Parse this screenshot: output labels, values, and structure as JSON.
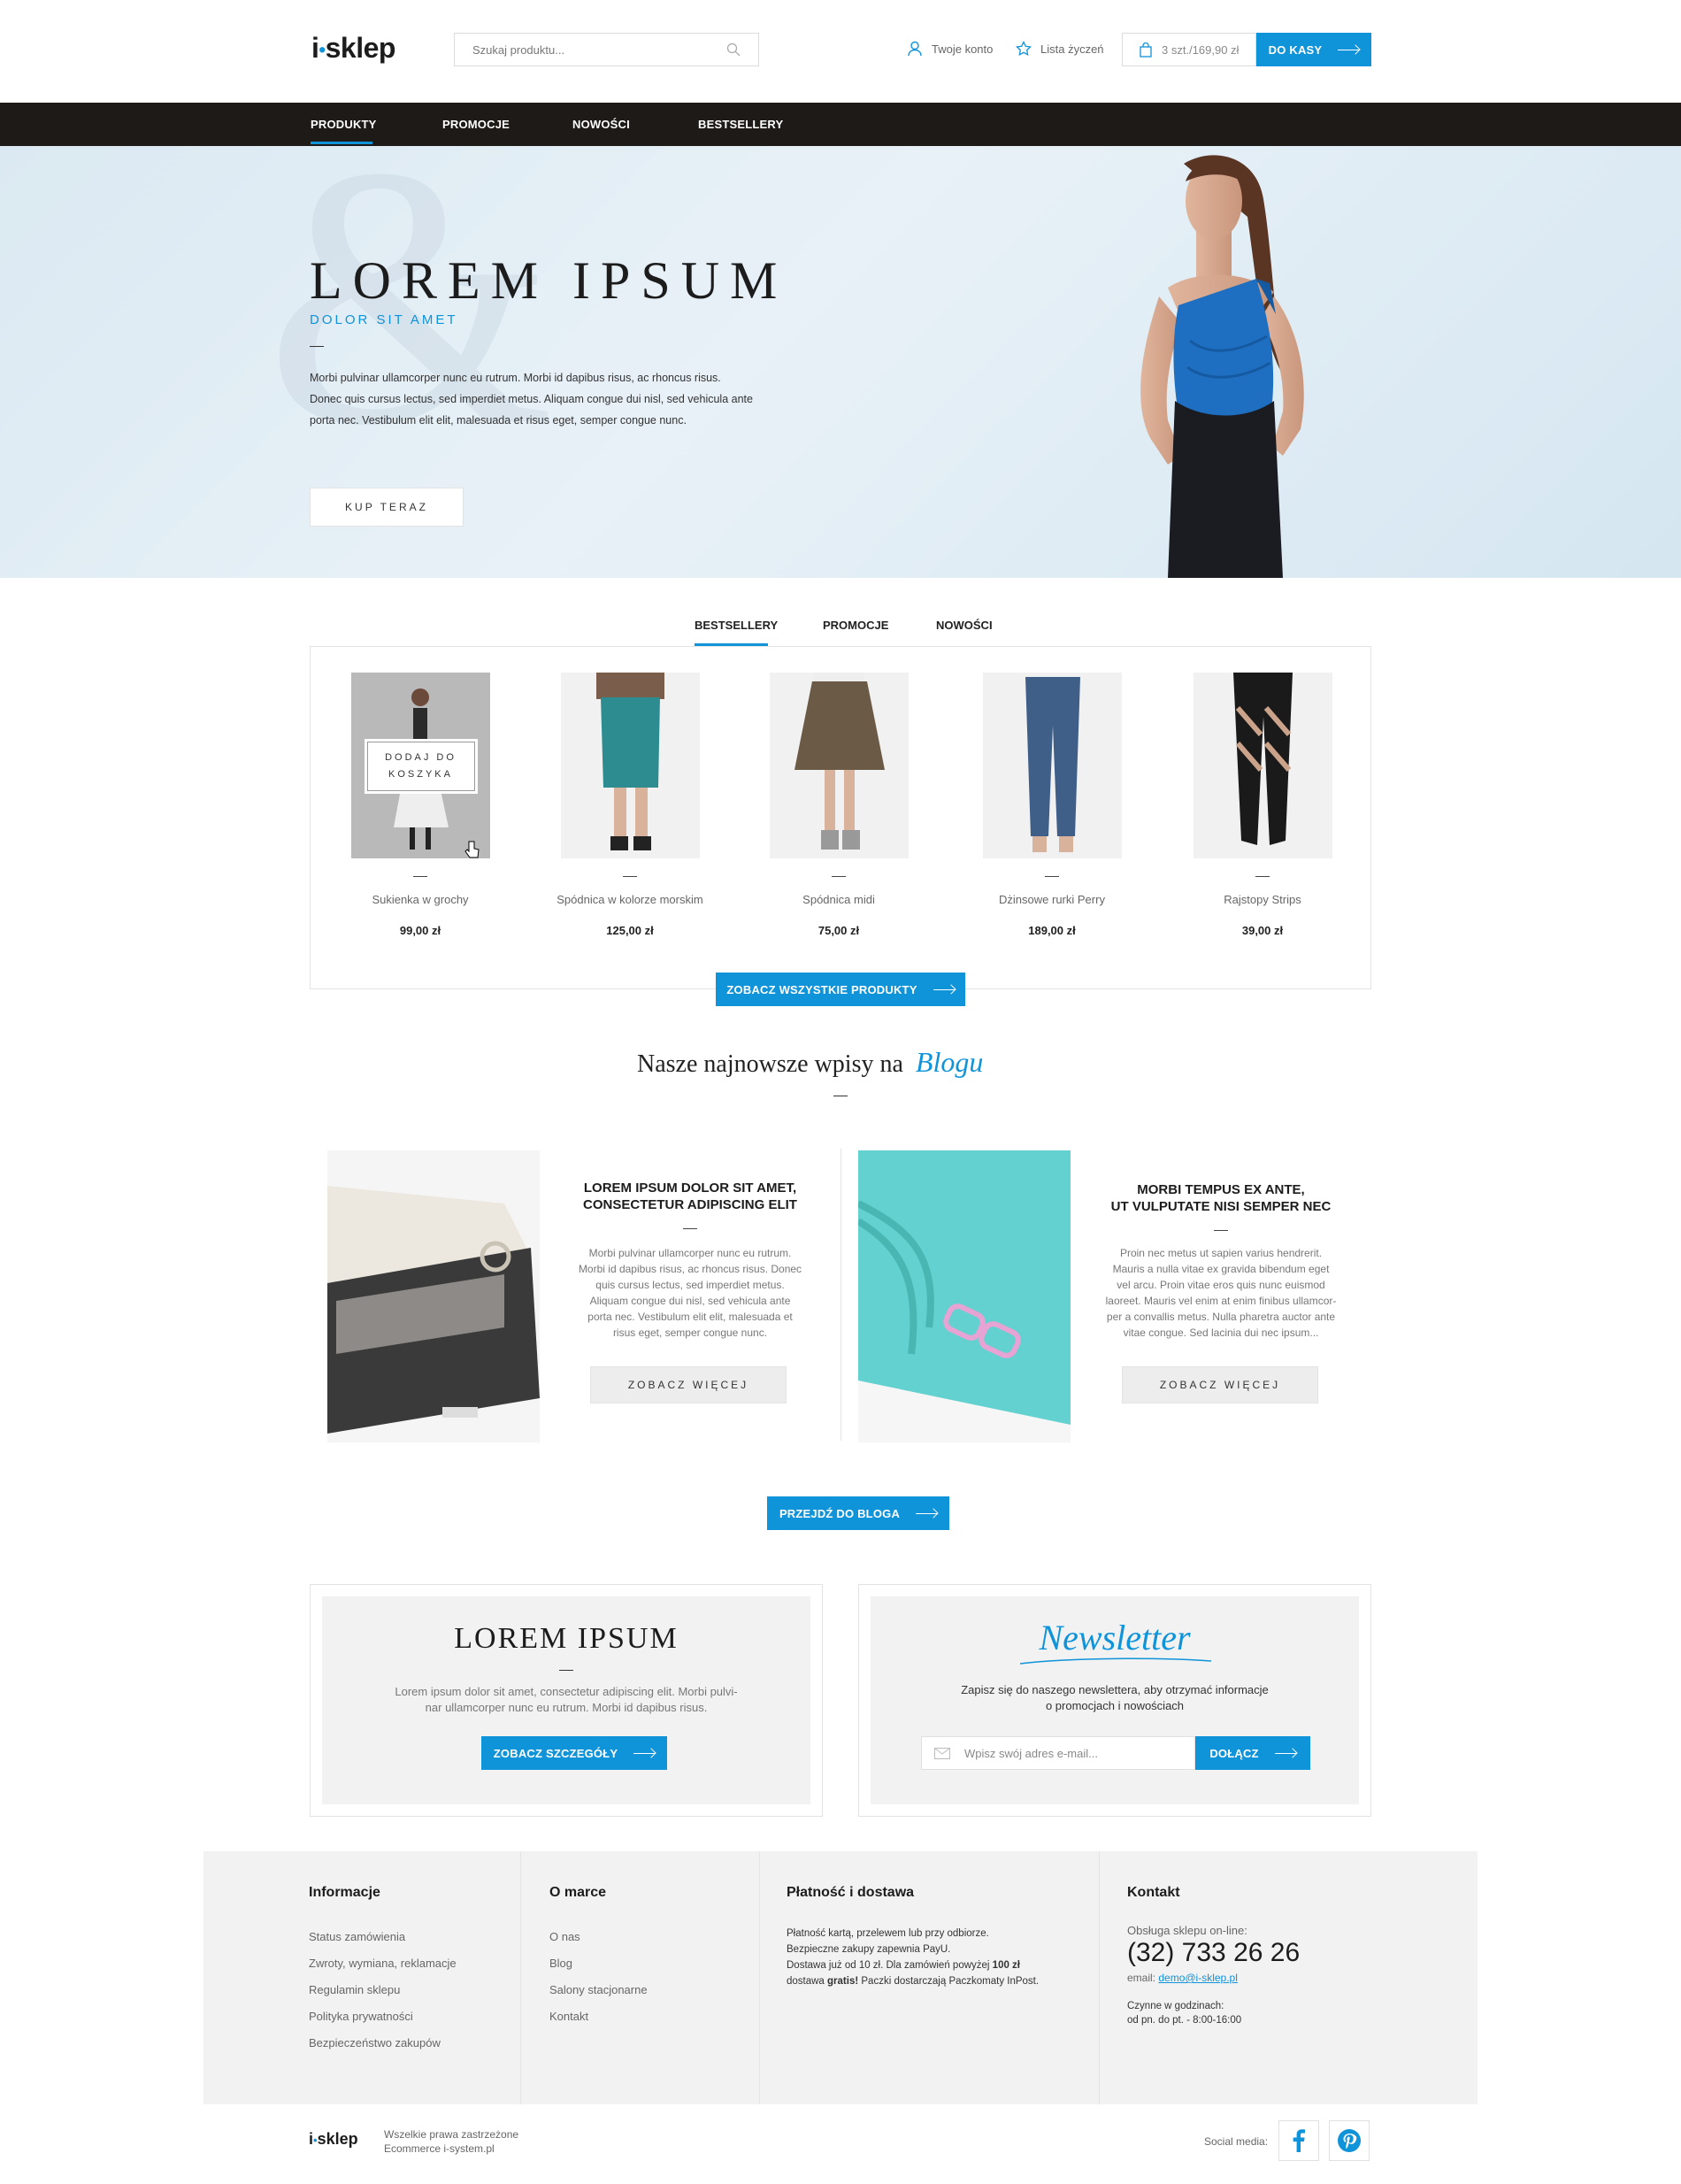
{
  "header": {
    "logo_prefix": "i",
    "logo_text": "sklep",
    "search_placeholder": "Szukaj produktu...",
    "account_label": "Twoje konto",
    "wishlist_label": "Lista życzeń",
    "cart_summary": "3 szt./169,90 zł",
    "checkout_label": "DO KASY"
  },
  "nav": {
    "items": [
      "PRODUKTY",
      "PROMOCJE",
      "NOWOŚCI",
      "BESTSELLERY"
    ],
    "active": "PRODUKTY"
  },
  "hero": {
    "title": "LOREM IPSUM",
    "subtitle": "DOLOR SIT AMET",
    "body_line1": "Morbi pulvinar ullamcorper nunc eu rutrum. Morbi id dapibus risus, ac rhoncus risus.",
    "body_line2": "Donec quis cursus lectus, sed imperdiet metus. Aliquam congue dui nisl, sed vehicula ante",
    "body_line3": "porta nec. Vestibulum elit elit, malesuada et risus eget, semper congue nunc.",
    "cta_label": "KUP TERAZ",
    "watermark": "&"
  },
  "product_tabs": {
    "items": [
      "BESTSELLERY",
      "PROMOCJE",
      "NOWOŚCI"
    ],
    "active": "BESTSELLERY"
  },
  "products": [
    {
      "name": "Sukienka w grochy",
      "price": "99,00 zł",
      "overlay_line1": "DODAJ DO",
      "overlay_line2": "KOSZYKA"
    },
    {
      "name": "Spódnica w kolorze morskim",
      "price": "125,00 zł"
    },
    {
      "name": "Spódnica midi",
      "price": "75,00 zł"
    },
    {
      "name": "Dżinsowe rurki Perry",
      "price": "189,00 zł"
    },
    {
      "name": "Rajstopy Strips",
      "price": "39,00 zł"
    }
  ],
  "see_all_label": "ZOBACZ WSZYSTKIE PRODUKTY",
  "blog": {
    "heading": "Nasze najnowsze wpisy na",
    "heading_script": "Blogu",
    "posts": [
      {
        "title_line1": "LOREM IPSUM DOLOR SIT AMET,",
        "title_line2": "CONSECTETUR ADIPISCING ELIT",
        "text": [
          "Morbi pulvinar ullamcorper nunc eu rutrum.",
          "Morbi id dapibus risus, ac rhoncus risus. Donec",
          "quis cursus lectus, sed imperdiet metus.",
          "Aliquam congue dui nisl, sed vehicula ante",
          "porta nec. Vestibulum elit elit, malesuada et",
          "risus eget, semper congue nunc."
        ],
        "button": "ZOBACZ WIĘCEJ"
      },
      {
        "title_line1": "MORBI TEMPUS EX ANTE,",
        "title_line2": "UT VULPUTATE NISI SEMPER NEC",
        "text": [
          "Proin nec metus ut sapien varius hendrerit.",
          "Mauris a nulla vitae ex gravida bibendum eget",
          "vel arcu. Proin vitae eros quis nunc euismod",
          "laoreet. Mauris vel enim at enim finibus ullamcor-",
          "per a convallis metus. Nulla pharetra auctor ante",
          "vitae congue. Sed lacinia dui nec ipsum..."
        ],
        "button": "ZOBACZ WIĘCEJ"
      }
    ],
    "go_to_blog_label": "PRZEJDŹ DO BLOGA"
  },
  "promo": {
    "title": "LOREM IPSUM",
    "text_line1": "Lorem ipsum dolor sit amet, consectetur adipiscing elit. Morbi pulvi-",
    "text_line2": "nar ullamcorper nunc eu rutrum. Morbi id dapibus risus.",
    "button": "ZOBACZ SZCZEGÓŁY"
  },
  "newsletter": {
    "title": "Newsletter",
    "text_line1": "Zapisz się do naszego newslettera, aby otrzymać informacje",
    "text_line2": "o promocjach i nowościach",
    "email_placeholder": "Wpisz swój adres e-mail...",
    "button": "DOŁĄCZ"
  },
  "footer": {
    "info": {
      "heading": "Informacje",
      "links": [
        "Status zamówienia",
        "Zwroty, wymiana, reklamacje",
        "Regulamin sklepu",
        "Polityka prywatności",
        "Bezpieczeństwo zakupów"
      ]
    },
    "brand": {
      "heading": "O marce",
      "links": [
        "O nas",
        "Blog",
        "Salony stacjonarne",
        "Kontakt"
      ]
    },
    "payment": {
      "heading": "Płatność i dostawa",
      "line1": "Płatność kartą, przelewem lub przy odbiorze.",
      "line2": "Bezpieczne zakupy zapewnia PayU.",
      "line3_a": "Dostawa już od 10 zł. Dla zamówień powyżej ",
      "line3_b": "100 zł",
      "line4_a": "dostawa ",
      "line4_b": "gratis!",
      "line4_c": " Paczki dostarczają Paczkomaty InPost."
    },
    "contact": {
      "heading": "Kontakt",
      "service_label": "Obsługa sklepu on-line:",
      "phone": "(32) 733 26 26",
      "email_label": "email: ",
      "email": "demo@i-sklep.pl",
      "hours_label": "Czynne w godzinach:",
      "hours": "od pn. do pt. -  8:00-16:00"
    },
    "bottom": {
      "logo_prefix": "i",
      "logo_text": "sklep",
      "rights": "Wszelkie prawa zastrzeżone",
      "by": "Ecommerce i-system.pl",
      "social_label": "Social media:"
    }
  },
  "colors": {
    "accent": "#0f93d9",
    "nav_bg": "#1e1a17",
    "panel_bg": "#f2f2f2"
  }
}
